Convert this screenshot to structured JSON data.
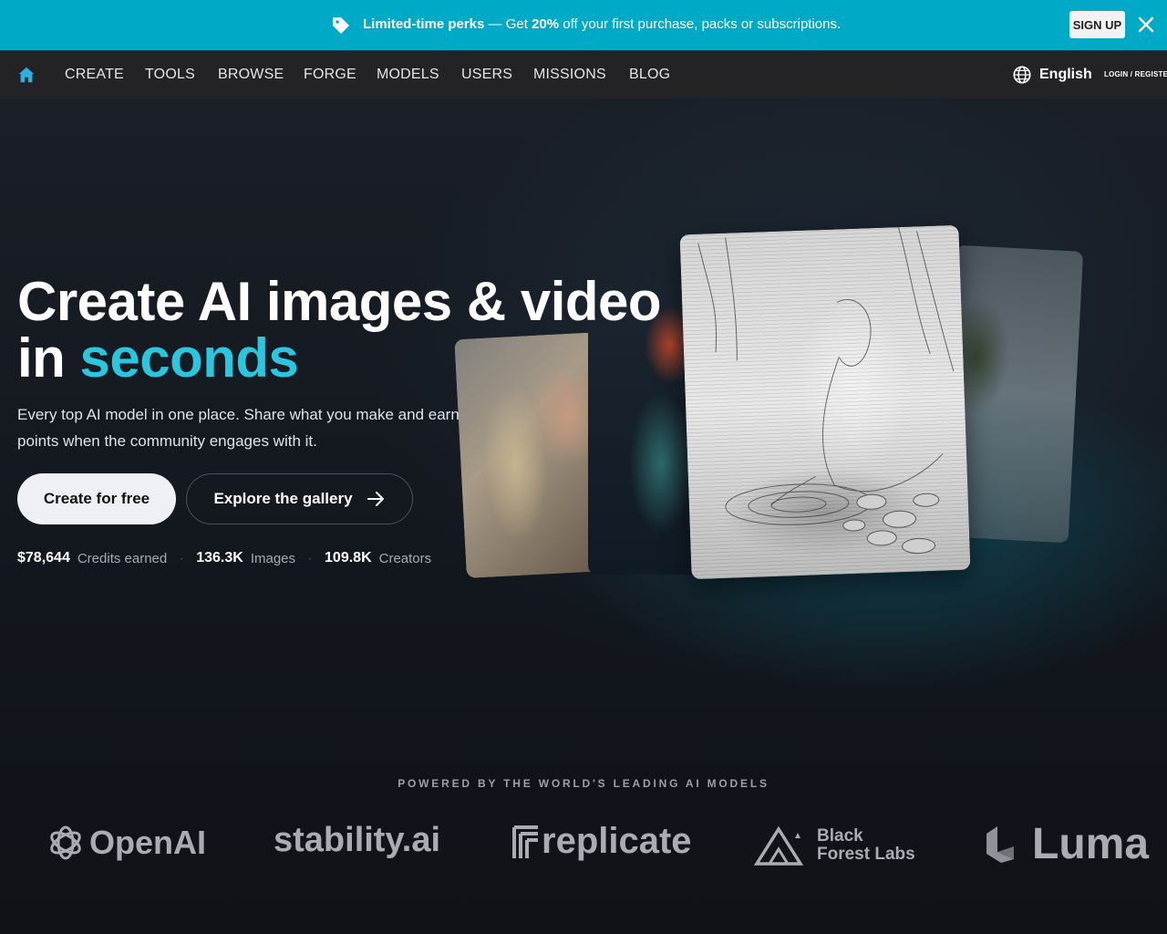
{
  "promo": {
    "lead": "Limited-time perks",
    "dash": "—",
    "get": "Get",
    "percent": "20%",
    "rest": "off your first purchase, packs or subscriptions.",
    "signup": "SIGN UP",
    "icons": {
      "tag": "tag-icon",
      "close": "close-icon"
    }
  },
  "nav": {
    "items": [
      "CREATE",
      "TOOLS",
      "BROWSE",
      "FORGE",
      "MODELS",
      "USERS",
      "MISSIONS",
      "BLOG"
    ],
    "language": "English",
    "login": "LOGIN / REGISTER",
    "icons": {
      "home": "home-icon",
      "globe": "globe-icon"
    }
  },
  "hero": {
    "title_line1": "Create AI images & video",
    "title_line2_prefix": "in",
    "title_line2_accent": "seconds",
    "subtitle": "Every top AI model in one place. Share what you make and earn points when the community engages with it.",
    "cta_primary": "Create for free",
    "cta_secondary": "Explore the gallery",
    "stats": [
      {
        "value": "$78,644",
        "label": "Credits earned"
      },
      {
        "value": "136.3K",
        "label": "Images"
      },
      {
        "value": "109.8K",
        "label": "Creators"
      }
    ]
  },
  "powered": {
    "heading": "POWERED BY THE WORLD'S LEADING AI MODELS",
    "logos": {
      "openai": "OpenAI",
      "stability": "stability.ai",
      "replicate": "replicate",
      "bfl_line1": "Black",
      "bfl_line2": "Forest Labs",
      "luma": "Luma"
    }
  },
  "colors": {
    "banner": "#00a9c6",
    "accent": "#2cc5de",
    "nav_bg": "#232325",
    "hero_bg": "#12161d"
  }
}
